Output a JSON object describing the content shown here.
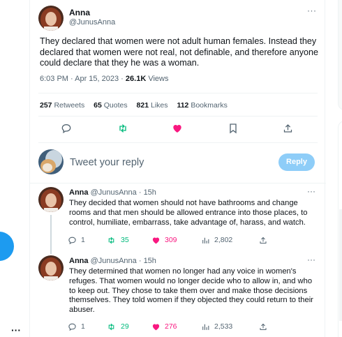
{
  "main_tweet": {
    "name": "Anna",
    "handle": "@JunusAnna",
    "more": "···",
    "text": "They declared that women were not adult human females. Instead they declared that women were not real, not definable, and therefore anyone could declare that they he was a woman.",
    "time": "6:03 PM · Apr 15, 2023 · ",
    "views_count": "26.1K",
    "views_label": " Views",
    "stats": {
      "retweets_count": "257",
      "retweets_label": "Retweets",
      "quotes_count": "65",
      "quotes_label": "Quotes",
      "likes_count": "821",
      "likes_label": "Likes",
      "bookmarks_count": "112",
      "bookmarks_label": "Bookmarks"
    }
  },
  "compose": {
    "placeholder": "Tweet your reply",
    "button_label": "Reply"
  },
  "replies": [
    {
      "name": "Anna",
      "handle": "@JunusAnna",
      "dot": " · ",
      "time": "15h",
      "more": "···",
      "text": "They decided that women should not have bathrooms and change rooms and that men should be allowed entrance into those places, to control, humiliate, embarrass, take advantage of, harass, and watch.",
      "replies": "1",
      "retweets": "35",
      "likes": "309",
      "views": "2,802"
    },
    {
      "name": "Anna",
      "handle": "@JunusAnna",
      "dot": " · ",
      "time": "15h",
      "more": "···",
      "text": "They determined that women no longer had any voice in women's refuges. That women would no longer decide  who to allow in, and who to keep out. They chose to take them over and make those decisions themselves. They told women if they objected they could return to their abuser.",
      "replies": "1",
      "retweets": "29",
      "likes": "276",
      "views": "2,533"
    }
  ],
  "left_rail": {
    "more": "···"
  },
  "colors": {
    "accent": "#1d9bf0",
    "like": "#f91880",
    "retweet": "#00ba7c",
    "muted": "#536471"
  },
  "icons": [
    "reply-icon",
    "retweet-icon",
    "like-icon",
    "bookmark-icon",
    "share-icon",
    "views-icon",
    "more-icon"
  ]
}
